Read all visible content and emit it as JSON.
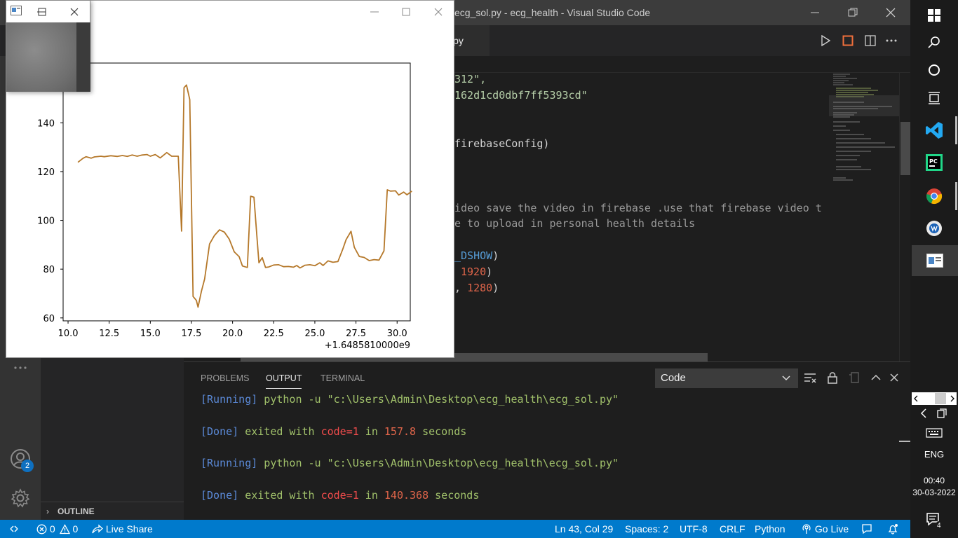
{
  "vscode": {
    "title": "ecg_sol.py - ecg_health - Visual Studio Code",
    "tab_label": "ecg_sol.py",
    "code": {
      "line1": "312\",",
      "line2": "162d1cd0dbf7ff5393cd\"",
      "line3": "firebaseConfig)",
      "line4": "ideo save the video in firebase .use that firebase video t",
      "line5": "e to upload in personal health details",
      "line6_kw": "_DSHOW",
      "line6_end": ")",
      "line7_num": "1920",
      "line7_end": ")",
      "line8_pre": ", ",
      "line8_num": "1280",
      "line8_end": ")"
    },
    "outline_label": "OUTLINE",
    "panel": {
      "tabs": [
        "PROBLEMS",
        "OUTPUT",
        "TERMINAL"
      ],
      "channel": "Code",
      "output": [
        {
          "bracket": "[Running]",
          "cmd": " python -u \"c:\\Users\\Admin\\Desktop\\ecg_health\\ecg_sol.py\""
        },
        {
          "bracket": "[Done]",
          "pre": " exited with ",
          "code": "code=1",
          "mid": " in ",
          "secs": "157.8",
          "post": " seconds"
        },
        {
          "bracket": "[Running]",
          "cmd": " python -u \"c:\\Users\\Admin\\Desktop\\ecg_health\\ecg_sol.py\""
        },
        {
          "bracket": "[Done]",
          "pre": " exited with ",
          "code": "code=1",
          "mid": " in ",
          "secs": "140.368",
          "post": " seconds"
        }
      ]
    },
    "accounts_badge": "2",
    "statusbar": {
      "errors": "0",
      "warnings": "0",
      "live_share": "Live Share",
      "position": "Ln 43, Col 29",
      "spaces": "Spaces: 2",
      "encoding": "UTF-8",
      "eol": "CRLF",
      "language": "Python",
      "go_live": "Go Live"
    },
    "colors": {
      "statusbar": "#007acc",
      "plot_line": "#b5782a"
    }
  },
  "plot_window": {
    "offset_label": "+1.6485810000e9"
  },
  "chart_data": {
    "type": "line",
    "title": "",
    "xlabel": "",
    "ylabel": "",
    "xlim": [
      9.7,
      30.8
    ],
    "ylim": [
      58.8,
      164.5
    ],
    "x_ticks": [
      "10.0",
      "12.5",
      "15.0",
      "17.5",
      "20.0",
      "22.5",
      "25.0",
      "27.5",
      "30.0"
    ],
    "y_ticks": [
      "60",
      "80",
      "100",
      "120",
      "140"
    ],
    "x_offset_text": "+1.6485810000e9",
    "grid": false,
    "series": [
      {
        "x": [
          10.6,
          10.9,
          11.1,
          11.4,
          11.6,
          12.0,
          12.2,
          12.6,
          13.0,
          13.3,
          13.6,
          13.9,
          14.2,
          14.5,
          14.8,
          15.0,
          15.3,
          15.6,
          16.0,
          16.3,
          16.7,
          16.9,
          17.05,
          17.2,
          17.4,
          17.6,
          17.8,
          17.9,
          18.1,
          18.3,
          18.6,
          18.9,
          19.2,
          19.5,
          19.8,
          20.1,
          20.4,
          20.6,
          20.9,
          21.1,
          21.3,
          21.5,
          21.6,
          21.8,
          22.0,
          22.2,
          22.5,
          22.8,
          23.1,
          23.4,
          23.7,
          23.9,
          24.1,
          24.4,
          24.7,
          25.0,
          25.3,
          25.5,
          25.8,
          26.1,
          26.4,
          26.7,
          26.9,
          27.2,
          27.4,
          27.7,
          28.0,
          28.3,
          28.6,
          28.9,
          29.2,
          29.4,
          29.6,
          29.9,
          30.1,
          30.4,
          30.6,
          30.9
        ],
        "y": [
          123.8,
          125.4,
          126.1,
          125.5,
          126.0,
          126.3,
          126.1,
          126.5,
          126.2,
          126.6,
          126.2,
          126.8,
          126.3,
          126.8,
          127.0,
          126.3,
          127.0,
          125.6,
          127.8,
          126.3,
          126.3,
          95.6,
          154.4,
          155.5,
          149.5,
          68.8,
          67.2,
          64.4,
          70.8,
          76.0,
          90.3,
          93.8,
          96.1,
          95.2,
          92.3,
          87.1,
          85.1,
          81.3,
          80.7,
          109.9,
          109.5,
          91.6,
          82.6,
          84.7,
          80.7,
          80.9,
          81.7,
          81.8,
          81.0,
          81.1,
          80.8,
          81.5,
          80.5,
          81.6,
          81.8,
          81.4,
          82.6,
          81.5,
          83.4,
          82.8,
          83.1,
          88.2,
          92.1,
          95.5,
          89.0,
          85.2,
          84.8,
          83.5,
          83.9,
          83.7,
          87.5,
          112.5,
          112.0,
          112.1,
          110.4,
          111.6,
          110.5,
          112.0
        ]
      }
    ]
  },
  "taskbar": {
    "language": "ENG",
    "time": "00:40",
    "date": "30-03-2022",
    "notification_count": "4"
  }
}
